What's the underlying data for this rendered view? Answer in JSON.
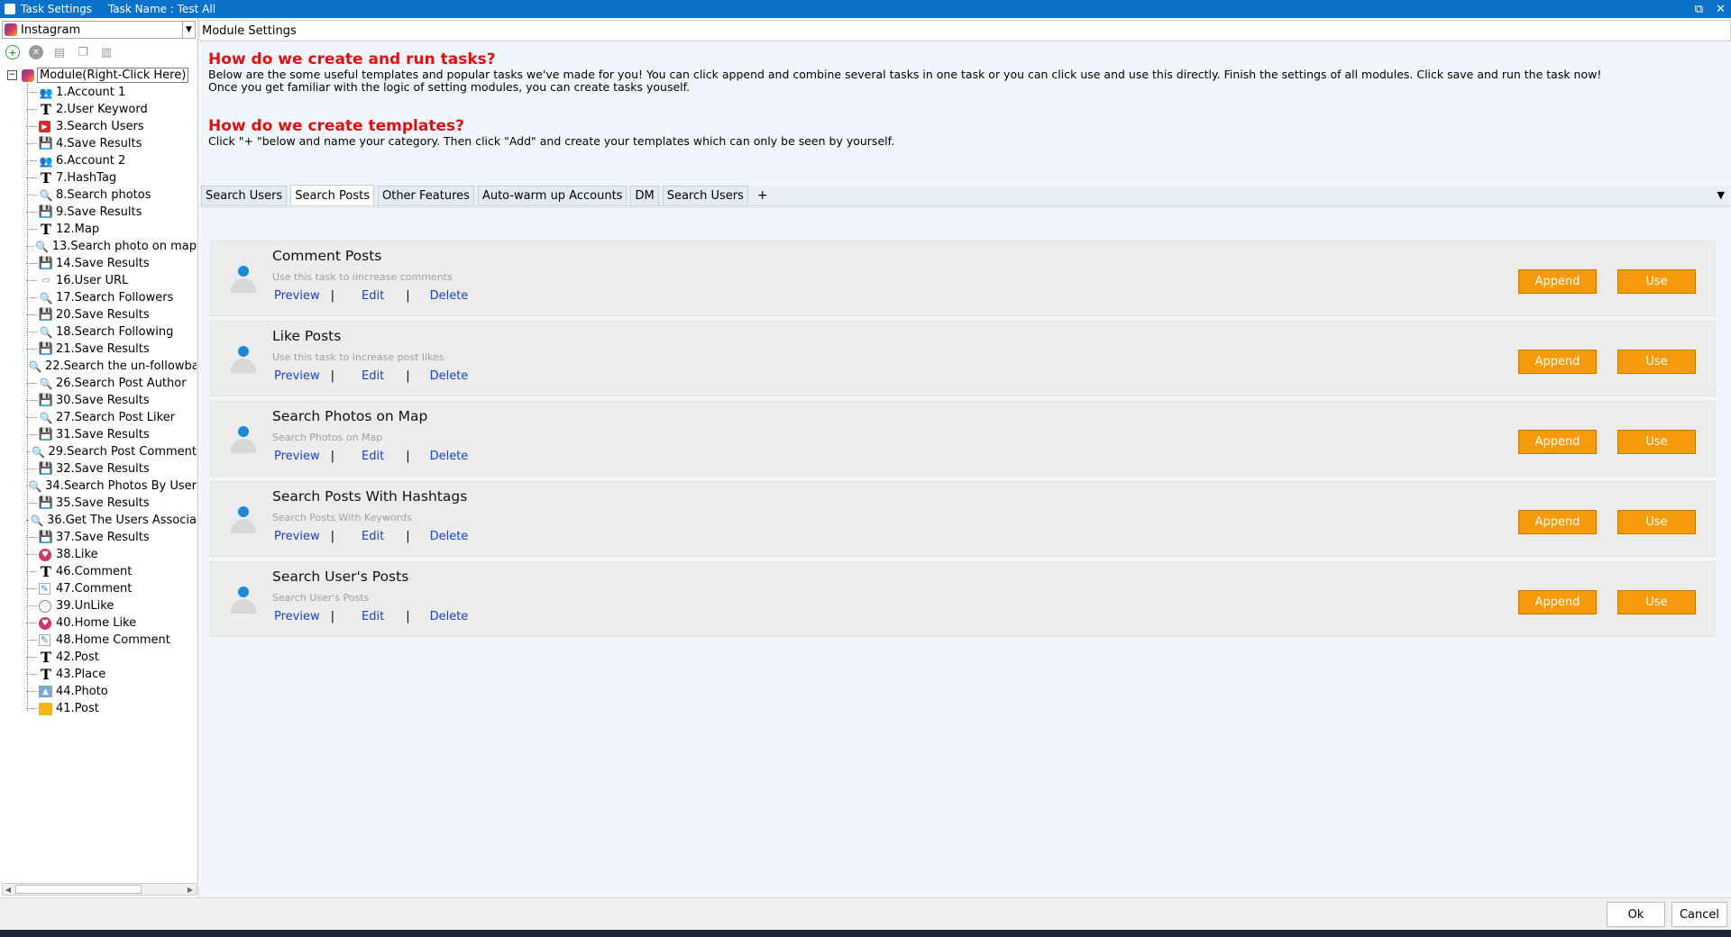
{
  "window": {
    "title": "Task Settings",
    "task_name": "Task Name : Test All",
    "restore_icon": "restore-icon",
    "close_icon": "close-icon"
  },
  "left_panel": {
    "platform": "Instagram",
    "toolbar": [
      "add-icon",
      "remove-icon",
      "doc-icon",
      "copy-icon",
      "paste-icon"
    ],
    "root_label": "Module(Right-Click Here)",
    "items": [
      {
        "label": "1.Account 1",
        "icon": "account"
      },
      {
        "label": "2.User Keyword",
        "icon": "text"
      },
      {
        "label": "3.Search Users",
        "icon": "searchusers"
      },
      {
        "label": "4.Save Results",
        "icon": "save"
      },
      {
        "label": "6.Account 2",
        "icon": "account"
      },
      {
        "label": "7.HashTag",
        "icon": "text"
      },
      {
        "label": "8.Search photos",
        "icon": "search"
      },
      {
        "label": "9.Save Results",
        "icon": "save"
      },
      {
        "label": "12.Map",
        "icon": "text"
      },
      {
        "label": "13.Search photo on map",
        "icon": "search"
      },
      {
        "label": "14.Save Results",
        "icon": "save"
      },
      {
        "label": "16.User URL",
        "icon": "url"
      },
      {
        "label": "17.Search Followers",
        "icon": "search"
      },
      {
        "label": "20.Save Results",
        "icon": "save"
      },
      {
        "label": "18.Search Following",
        "icon": "search"
      },
      {
        "label": "21.Save Results",
        "icon": "save"
      },
      {
        "label": "22.Search the un-followba",
        "icon": "search"
      },
      {
        "label": "26.Search Post Author",
        "icon": "search"
      },
      {
        "label": "30.Save Results",
        "icon": "save"
      },
      {
        "label": "27.Search Post Liker",
        "icon": "search"
      },
      {
        "label": "31.Save Results",
        "icon": "save"
      },
      {
        "label": "29.Search Post Comment",
        "icon": "search"
      },
      {
        "label": "32.Save Results",
        "icon": "save"
      },
      {
        "label": "34.Search Photos By User",
        "icon": "search"
      },
      {
        "label": "35.Save Results",
        "icon": "save"
      },
      {
        "label": "36.Get The Users Associa",
        "icon": "search"
      },
      {
        "label": "37.Save Results",
        "icon": "save"
      },
      {
        "label": "38.Like",
        "icon": "like"
      },
      {
        "label": "46.Comment",
        "icon": "text"
      },
      {
        "label": "47.Comment",
        "icon": "comment"
      },
      {
        "label": "39.UnLike",
        "icon": "unlike"
      },
      {
        "label": "40.Home Like",
        "icon": "like"
      },
      {
        "label": "48.Home Comment",
        "icon": "comment"
      },
      {
        "label": "42.Post",
        "icon": "text"
      },
      {
        "label": "43.Place",
        "icon": "text"
      },
      {
        "label": "44.Photo",
        "icon": "photo"
      },
      {
        "label": "41.Post",
        "icon": "post"
      }
    ]
  },
  "main": {
    "header": "Module Settings",
    "heading1": "How do we create and run tasks?",
    "para1_line1": "Below are the some useful templates and popular tasks we've made for you!  You can click append and combine several tasks in one task or you can click use and use this directly. Finish the settings of all modules. Click save and run the task now!",
    "para1_line2": "Once you get familiar with the logic of setting modules, you can create tasks youself.",
    "heading2": "How do we create templates?",
    "para2": "Click \"+ \"below and name your category. Then click \"Add\" and create your templates which can only be seen by yourself.",
    "tabs": [
      {
        "label": "Search Users",
        "active": false
      },
      {
        "label": "Search Posts",
        "active": true
      },
      {
        "label": "Other Features",
        "active": false
      },
      {
        "label": "Auto-warm up Accounts",
        "active": false
      },
      {
        "label": "DM",
        "active": false
      },
      {
        "label": "Search Users",
        "active": false
      }
    ],
    "add_tab": "+",
    "cards": [
      {
        "title": "Comment Posts",
        "desc": "Use this task to iincrease comments"
      },
      {
        "title": "Like Posts",
        "desc": "Use this task to increase post likes"
      },
      {
        "title": "Search Photos on Map",
        "desc": "Search Photos on Map"
      },
      {
        "title": "Search Posts With Hashtags",
        "desc": "Search Posts With Keywords"
      },
      {
        "title": "Search User's Posts",
        "desc": "Search User's Posts"
      }
    ],
    "card_actions": {
      "preview": "Preview",
      "edit": "Edit",
      "delete": "Delete",
      "separator": "|",
      "append": "Append",
      "use": "Use"
    }
  },
  "footer": {
    "ok": "Ok",
    "cancel": "Cancel"
  },
  "colors": {
    "titlebar": "#0a73c9",
    "heading": "#e01010",
    "button": "#f59a0b",
    "link": "#1a44c8",
    "avatar": "#1a8ad8"
  }
}
